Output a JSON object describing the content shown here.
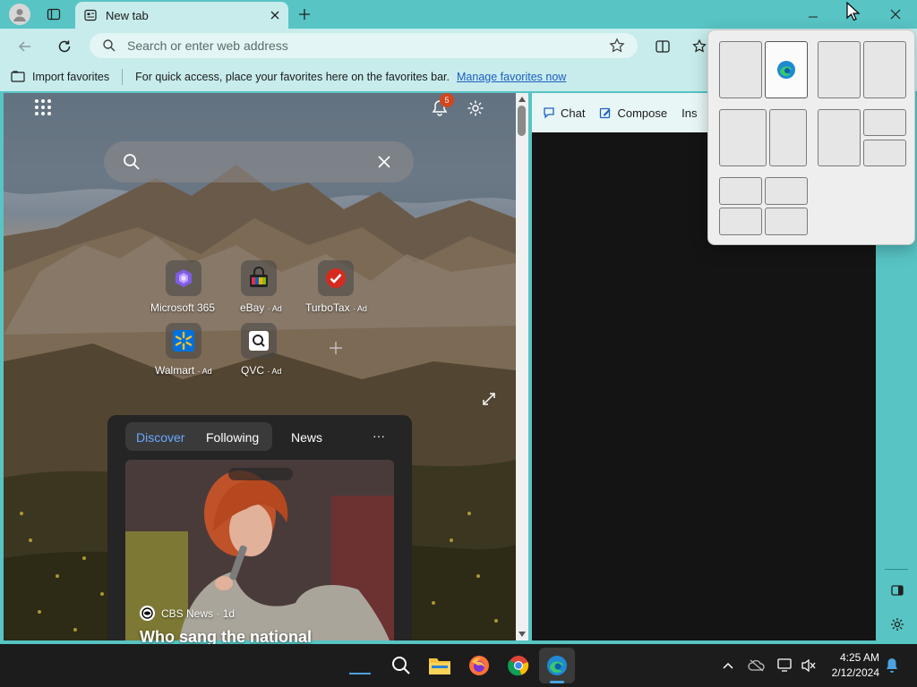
{
  "browser": {
    "tab_title": "New tab",
    "address_placeholder": "Search or enter web address",
    "favorites": {
      "import_label": "Import favorites",
      "message": "For quick access, place your favorites here on the favorites bar.",
      "manage_link": "Manage favorites now"
    }
  },
  "newtab": {
    "notification_count": "5",
    "quick_links": [
      {
        "label": "Microsoft 365",
        "ad": ""
      },
      {
        "label": "eBay",
        "ad": "· Ad"
      },
      {
        "label": "TurboTax",
        "ad": "· Ad"
      },
      {
        "label": "Walmart",
        "ad": "· Ad"
      },
      {
        "label": "QVC",
        "ad": "· Ad"
      }
    ],
    "feed": {
      "tabs": [
        "Discover",
        "Following",
        "News"
      ],
      "more_label": "···",
      "story": {
        "source": "CBS News",
        "age": "· 1d",
        "headline": "Who sang the national"
      }
    }
  },
  "sidebar": {
    "tabs": [
      "Chat",
      "Compose",
      "Ins"
    ]
  },
  "taskbar": {
    "time": "4:25 AM",
    "date": "2/12/2024"
  },
  "colors": {
    "accent": "#58c4c4",
    "toolbar": "#c7eceb",
    "link": "#1d5fc2",
    "badge": "#d2451e"
  }
}
